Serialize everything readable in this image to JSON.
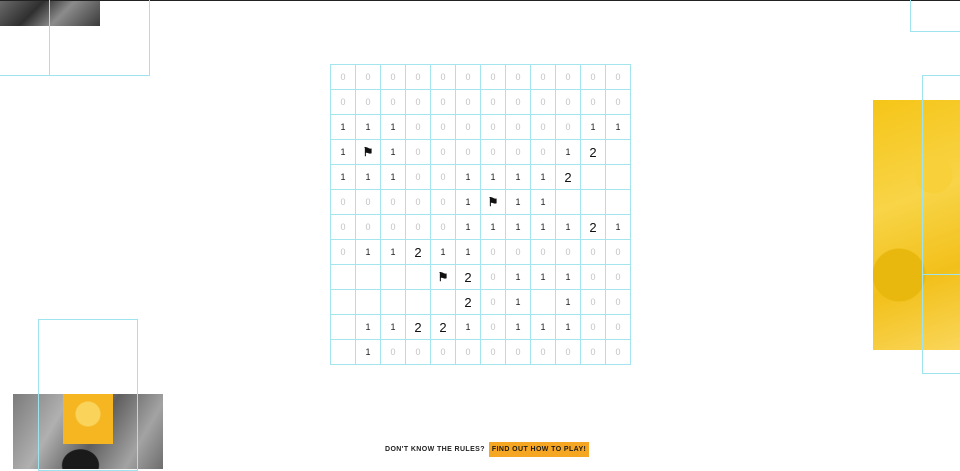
{
  "board": {
    "flag_glyph": "⚑",
    "rows": [
      [
        "0",
        "0",
        "0",
        "0",
        "0",
        "0",
        "0",
        "0",
        "0",
        "0",
        "0",
        "0"
      ],
      [
        "0",
        "0",
        "0",
        "0",
        "0",
        "0",
        "0",
        "0",
        "0",
        "0",
        "0",
        "0"
      ],
      [
        "1",
        "1",
        "1",
        "0",
        "0",
        "0",
        "0",
        "0",
        "0",
        "0",
        "1",
        "1"
      ],
      [
        "1",
        "F",
        "1",
        "0",
        "0",
        "0",
        "0",
        "0",
        "0",
        "1",
        "2",
        ""
      ],
      [
        "1",
        "1",
        "1",
        "0",
        "0",
        "1",
        "1",
        "1",
        "1",
        "2",
        "",
        ""
      ],
      [
        "0",
        "0",
        "0",
        "0",
        "0",
        "1",
        "F",
        "1",
        "1",
        "",
        "",
        ""
      ],
      [
        "0",
        "0",
        "0",
        "0",
        "0",
        "1",
        "1",
        "1",
        "1",
        "1",
        "2",
        "1"
      ],
      [
        "0",
        "1",
        "1",
        "2",
        "1",
        "1",
        "0",
        "0",
        "0",
        "0",
        "0",
        "0"
      ],
      [
        "",
        "",
        "",
        "",
        "F",
        "2",
        "0",
        "1",
        "1",
        "1",
        "0",
        "0"
      ],
      [
        "",
        "",
        "",
        "",
        "",
        "2",
        "0",
        "1",
        "",
        "1",
        "0",
        "0"
      ],
      [
        "",
        "1",
        "1",
        "2",
        "2",
        "1",
        "0",
        "1",
        "1",
        "1",
        "0",
        "0"
      ],
      [
        "",
        "1",
        "0",
        "0",
        "0",
        "0",
        "0",
        "0",
        "0",
        "0",
        "0",
        "0"
      ]
    ]
  },
  "footer": {
    "question": "DON'T KNOW THE RULES?",
    "cta_label": "FIND OUT HOW TO PLAY!"
  },
  "colors": {
    "grid_line": "#a3e4ee",
    "cta_background": "#f5a623",
    "accent_yellow": "#f5c518"
  }
}
